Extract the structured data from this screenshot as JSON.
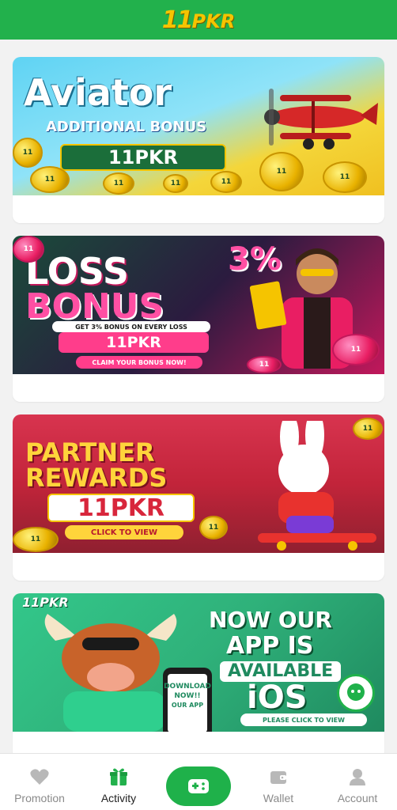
{
  "header": {
    "logo_number": "11",
    "logo_text": "PKR"
  },
  "cards": [
    {
      "title": "Aviator",
      "subtitle": "ADDITIONAL BONUS",
      "badge": "11PKR"
    },
    {
      "title_line1": "LOSS",
      "percent": "3%",
      "title_line2": "BONUS",
      "caption": "GET 3% BONUS ON EVERY LOSS",
      "badge": "11PKR",
      "cta": "CLAIM YOUR BONUS NOW!"
    },
    {
      "title_line1": "PARTNER",
      "title_line2": "REWARDS",
      "badge": "11PKR",
      "cta": "CLICK TO VIEW"
    },
    {
      "tag": "11PKR",
      "title_line1": "NOW OUR",
      "title_line2": "APP IS",
      "title_line3": "AVAILABLE",
      "title_line4": "iOS",
      "cta": "PLEASE CLICK TO VIEW",
      "phone_text": "DOWNLOAD NOW!! OUR APP"
    }
  ],
  "tabbar": {
    "promotion": "Promotion",
    "activity": "Activity",
    "wallet": "Wallet",
    "account": "Account"
  },
  "colors": {
    "brand_green": "#22b14c",
    "center_button": "#1fb14a",
    "gold": "#f5c400"
  },
  "icons": {
    "promotion": "heart-icon",
    "activity": "gift-icon",
    "center": "gamepad-icon",
    "wallet": "wallet-icon",
    "account": "user-icon"
  }
}
